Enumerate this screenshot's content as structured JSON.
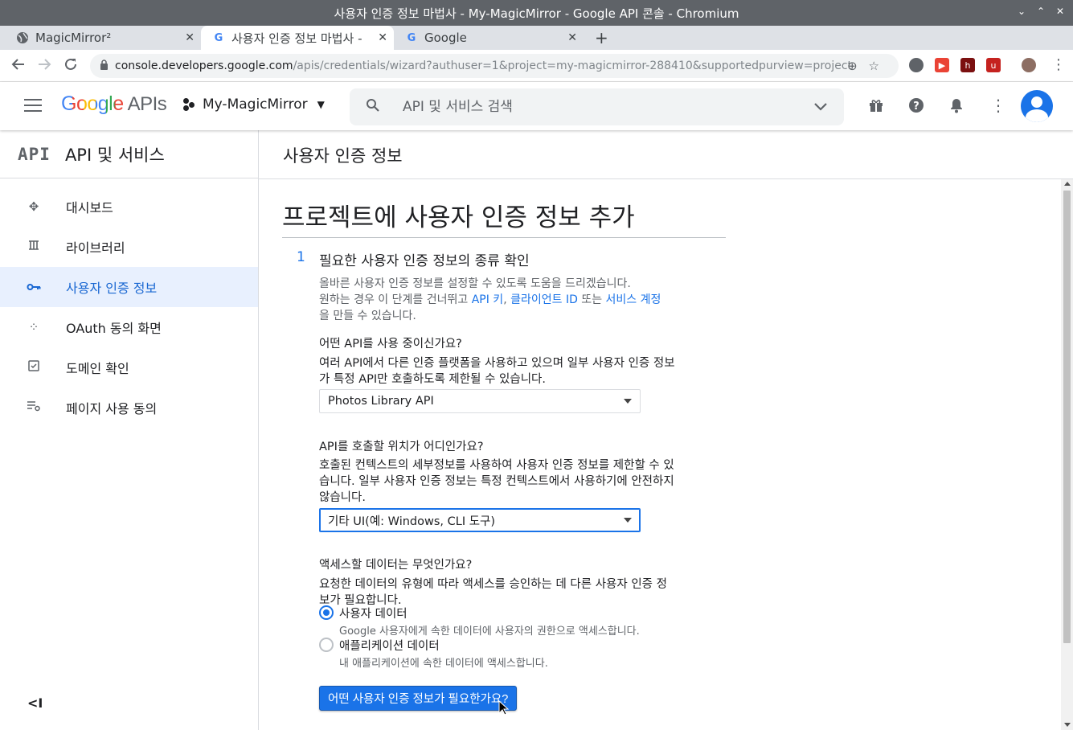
{
  "window": {
    "title": "사용자 인증 정보 마법사 - My-MagicMirror - Google API 콘솔 - Chromium",
    "controls": [
      "⌄",
      "⌃",
      "✕"
    ]
  },
  "tabs": [
    {
      "title": "MagicMirror²",
      "favicon": "globe-icon",
      "active": false
    },
    {
      "title": "사용자 인증 정보 마법사 -",
      "favicon": "google-g-icon",
      "active": true
    },
    {
      "title": "Google",
      "favicon": "google-g-icon",
      "active": false
    }
  ],
  "tab_close": "✕",
  "new_tab": "+",
  "address": {
    "host": "console.developers.google.com",
    "path": "/apis/credentials/wizard?authuser=1&project=my-magicmirror-288410&supportedpurview=project"
  },
  "header": {
    "logo_google": "Google",
    "logo_apis": "APIs",
    "project": "My-MagicMirror",
    "search_placeholder": "API 및 서비스 검색"
  },
  "sidebar": {
    "logo": "API",
    "title": "API 및 서비스",
    "items": [
      {
        "label": "대시보드",
        "icon": "dashboard-icon"
      },
      {
        "label": "라이브러리",
        "icon": "library-icon"
      },
      {
        "label": "사용자 인증 정보",
        "icon": "key-icon",
        "active": true
      },
      {
        "label": "OAuth 동의 화면",
        "icon": "oauth-consent-icon"
      },
      {
        "label": "도메인 확인",
        "icon": "domain-check-icon"
      },
      {
        "label": "페이지 사용 동의",
        "icon": "page-usage-icon"
      }
    ],
    "collapse": "<I"
  },
  "main": {
    "header_title": "사용자 인증 정보",
    "page_title": "프로젝트에 사용자 인증 정보 추가",
    "step_number": "1",
    "step_title": "필요한 사용자 인증 정보의 종류 확인",
    "intro_line1": "올바른 사용자 인증 정보를 설정할 수 있도록 도움을 드리겠습니다.",
    "intro_line2_prefix": "원하는 경우 이 단계를 건너뛰고 ",
    "link_api_key": "API 키",
    "intro_sep": ", ",
    "link_client_id": "클라이언트 ID",
    "intro_or": " 또는 ",
    "link_service_account": "서비스 계정",
    "intro_line3": "을 만들 수 있습니다.",
    "q1": "어떤 API를 사용 중이신가요?",
    "q1_desc_l1": "여러 API에서 다른 인증 플랫폼을 사용하고 있으며 일부 사용자 인증 정보",
    "q1_desc_l2": "가 특정 API만 호출하도록 제한될 수 있습니다.",
    "q1_value": "Photos Library API",
    "q2": "API를 호출할 위치가 어디인가요?",
    "q2_desc_l1": "호출된 컨텍스트의 세부정보를 사용하여 사용자 인증 정보를 제한할 수 있",
    "q2_desc_l2": "습니다. 일부 사용자 인증 정보는 특정 컨텍스트에서 사용하기에 안전하지",
    "q2_desc_l3": "않습니다.",
    "q2_value": "기타 UI(예: Windows, CLI 도구)",
    "q3": "액세스할 데이터는 무엇인가요?",
    "q3_desc_l1": "요청한 데이터의 유형에 따라 액세스를 승인하는 데 다른 사용자 인증 정",
    "q3_desc_l2": "보가 필요합니다.",
    "radio1_label": "사용자 데이터",
    "radio1_desc": "Google 사용자에게 속한 데이터에 사용자의 권한으로 액세스합니다.",
    "radio2_label": "애플리케이션 데이터",
    "radio2_desc": "내 애플리케이션에 속한 데이터에 액세스합니다.",
    "cta": "어떤 사용자 인증 정보가 필요한가요?"
  },
  "colors": {
    "accent": "#1a73e8",
    "active_bg": "#e8f0fe"
  }
}
